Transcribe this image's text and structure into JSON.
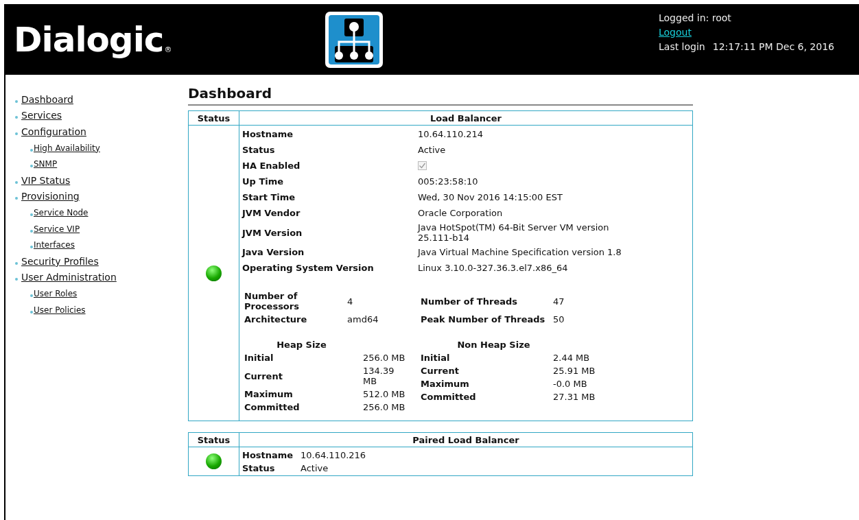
{
  "header": {
    "logo_text": "Dialogic",
    "logo_mark": "®",
    "logged_in": "Logged in: root",
    "logout": "Logout",
    "last_login_label": "Last login",
    "last_login": "12:17:11 PM Dec 6, 2016"
  },
  "sidebar": {
    "items": [
      {
        "label": "Dashboard"
      },
      {
        "label": "Services"
      },
      {
        "label": "Configuration",
        "children": [
          {
            "label": "High Availability"
          },
          {
            "label": "SNMP"
          }
        ]
      },
      {
        "label": "VIP Status"
      },
      {
        "label": "Provisioning",
        "children": [
          {
            "label": "Service Node"
          },
          {
            "label": "Service VIP"
          },
          {
            "label": "Interfaces"
          }
        ]
      },
      {
        "label": "Security Profiles"
      },
      {
        "label": "User Administration",
        "children": [
          {
            "label": "User Roles"
          },
          {
            "label": "User Policies"
          }
        ]
      }
    ]
  },
  "page_title": "Dashboard",
  "load_balancer": {
    "status_header": "Status",
    "title": "Load Balancer",
    "online": true,
    "properties": [
      {
        "kind": "text",
        "label": "Hostname",
        "value": "10.64.110.214"
      },
      {
        "kind": "text",
        "label": "Status",
        "value": "Active"
      },
      {
        "kind": "checkbox",
        "label": "HA Enabled",
        "checked": true,
        "disabled": true
      },
      {
        "kind": "text",
        "label": "Up Time",
        "value": "005:23:58:10"
      },
      {
        "kind": "text",
        "label": "Start Time",
        "value": "Wed, 30 Nov 2016 14:15:00 EST"
      },
      {
        "kind": "text",
        "label": "JVM Vendor",
        "value": "Oracle Corporation"
      },
      {
        "kind": "text",
        "label": "JVM Version",
        "value": "Java HotSpot(TM) 64-Bit Server VM version 25.111-b14"
      },
      {
        "kind": "text",
        "label": "Java Version",
        "value": "Java Virtual Machine Specification version 1.8"
      },
      {
        "kind": "text",
        "label": "Operating System Version",
        "value": "Linux 3.10.0-327.36.3.el7.x86_64"
      }
    ],
    "system": [
      [
        {
          "label": "Number of Processors",
          "value": "4"
        },
        {
          "label": "Number of Threads",
          "value": "47"
        }
      ],
      [
        {
          "label": "Architecture",
          "value": "amd64"
        },
        {
          "label": "Peak Number of Threads",
          "value": "50"
        }
      ]
    ],
    "memory": [
      {
        "title": "Heap Size",
        "rows": [
          {
            "label": "Initial",
            "value": "256.0 MB"
          },
          {
            "label": "Current",
            "value": "134.39 MB"
          },
          {
            "label": "Maximum",
            "value": "512.0 MB"
          },
          {
            "label": "Committed",
            "value": "256.0 MB"
          }
        ]
      },
      {
        "title": "Non Heap Size",
        "rows": [
          {
            "label": "Initial",
            "value": "2.44 MB"
          },
          {
            "label": "Current",
            "value": "25.91 MB"
          },
          {
            "label": "Maximum",
            "value": "-0.0 MB"
          },
          {
            "label": "Committed",
            "value": "27.31 MB"
          }
        ]
      }
    ]
  },
  "paired_load_balancer": {
    "status_header": "Status",
    "title": "Paired Load Balancer",
    "online": true,
    "properties": [
      {
        "kind": "text",
        "label": "Hostname",
        "value": "10.64.110.216"
      },
      {
        "kind": "text",
        "label": "Status",
        "value": "Active"
      }
    ]
  }
}
